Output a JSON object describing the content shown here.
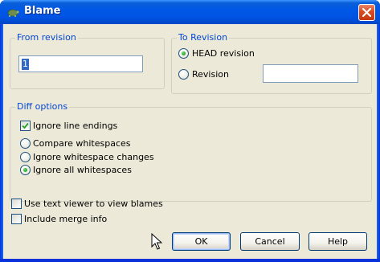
{
  "window": {
    "title": "Blame",
    "app_icon": "tortoise-icon",
    "close_icon": "close-icon"
  },
  "from_revision": {
    "label": "From revision",
    "value": "1"
  },
  "to_revision": {
    "label": "To Revision",
    "head_option": "HEAD revision",
    "revision_option": "Revision",
    "revision_value": "",
    "selected": "head"
  },
  "diff_options": {
    "label": "Diff options",
    "ignore_line_endings": {
      "label": "Ignore line endings",
      "checked": true
    },
    "compare_whitespaces": "Compare whitespaces",
    "ignore_whitespace_changes": "Ignore whitespace changes",
    "ignore_all_whitespaces": "Ignore all whitespaces",
    "selected": "ignore_all"
  },
  "use_text_viewer": {
    "label": "Use text viewer to view blames",
    "checked": false
  },
  "include_merge_info": {
    "label": "Include merge info",
    "checked": false
  },
  "buttons": {
    "ok": "OK",
    "cancel": "Cancel",
    "help": "Help"
  }
}
